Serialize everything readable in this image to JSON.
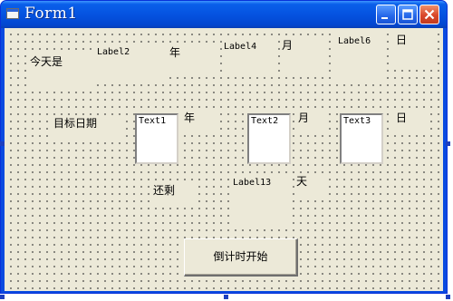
{
  "window": {
    "title": "Form1"
  },
  "labels": {
    "today": "今天是",
    "label2": "Label2",
    "year1": "年",
    "label4": "Label4",
    "month1": "月",
    "label6": "Label6",
    "day1": "日",
    "target_date": "目标日期",
    "year2": "年",
    "month2": "月",
    "day2": "日",
    "remaining": "还剩",
    "label13": "Label13",
    "days": "天"
  },
  "textboxes": {
    "text1": "Text1",
    "text2": "Text2",
    "text3": "Text3"
  },
  "buttons": {
    "start": "倒计时开始"
  },
  "colors": {
    "form_bg": "#ece9d8",
    "titlebar": "#0553e0",
    "close_button": "#d9472a"
  }
}
